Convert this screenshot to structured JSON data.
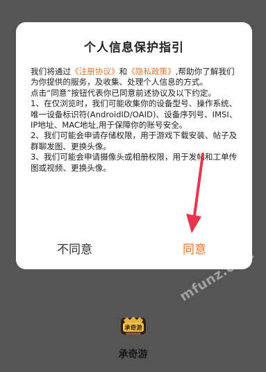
{
  "dialog": {
    "title": "个人信息保护指引",
    "intro_pre": "我们将通过",
    "link_user_agreement": "《注册协议》",
    "intro_and": "和",
    "link_privacy_policy": "《隐私政策》",
    "intro_post": ",帮助你了解我们为你提供的服务，及收集、处理个人信息的方式。",
    "consent_note": "点击“同意”按钮代表你已同意前述协议及以下约定。",
    "item1": "1、在仅浏览时，我们可能收集你的设备型号、操作系统、唯一设备标识符(AndroidID/OAID)、设备序列号、IMSI、IP地址、MAC地址,用于保障你的账号安全。",
    "item2": "2、我们可能会申请存储权限，用于游戏下载安装、帖子及群聊发图、更换头像。",
    "item3": "3、我们可能会申请摄像头或相册权限，用于发帖和工单传图或视频、更换头像。",
    "disagree_label": "不同意",
    "agree_label": "同意"
  },
  "watermark": {
    "cn": "魔趣网",
    "en": "mfunz.com"
  },
  "app": {
    "name": "承奇游",
    "logo_text": "承奇游"
  },
  "colors": {
    "accent": "#e8742a",
    "backdrop": "#555555",
    "arrow": "#e8344c"
  }
}
